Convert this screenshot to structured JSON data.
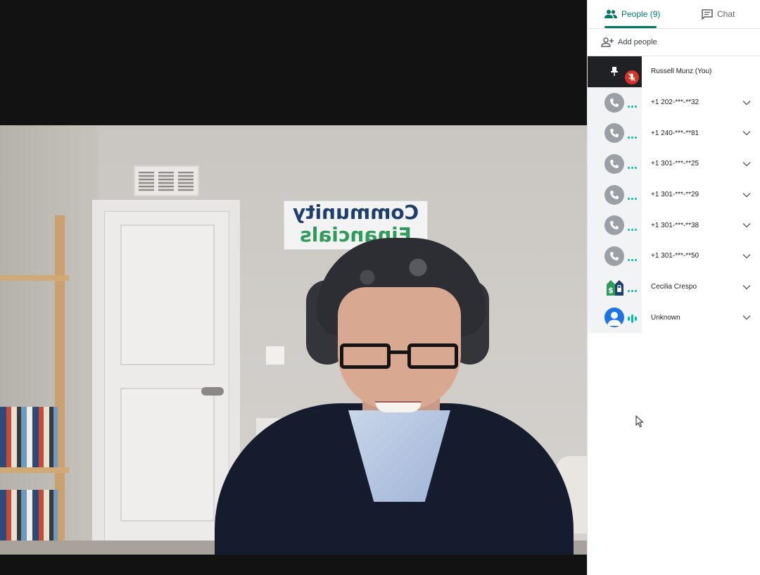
{
  "sidebar": {
    "tabs": {
      "people_label": "People (9)",
      "chat_label": "Chat"
    },
    "add_people_label": "Add people",
    "participants": [
      {
        "name": "Russell Munz (You)"
      },
      {
        "name": "+1 202-***-**32"
      },
      {
        "name": "+1 240-***-**81"
      },
      {
        "name": "+1 301-***-**25"
      },
      {
        "name": "+1 301-***-**29"
      },
      {
        "name": "+1 301-***-**38"
      },
      {
        "name": "+1 301-***-**50"
      },
      {
        "name": "Cecilia Crespo"
      },
      {
        "name": "Unknown"
      }
    ]
  },
  "video": {
    "sign_line1": "Community",
    "sign_line2": "Financials"
  },
  "icons": {
    "people_tab": "people-icon",
    "chat_tab": "chat-icon",
    "add_people": "person-add-icon",
    "pin": "pin-icon",
    "mic_off": "mic-off-icon",
    "phone": "phone-icon",
    "expand": "chevron-down-icon",
    "default_avatar": "person-avatar-icon"
  },
  "colors": {
    "accent": "#00796b",
    "speaking": "#00bfa5",
    "muted": "#d93025",
    "stage": "#121212"
  }
}
